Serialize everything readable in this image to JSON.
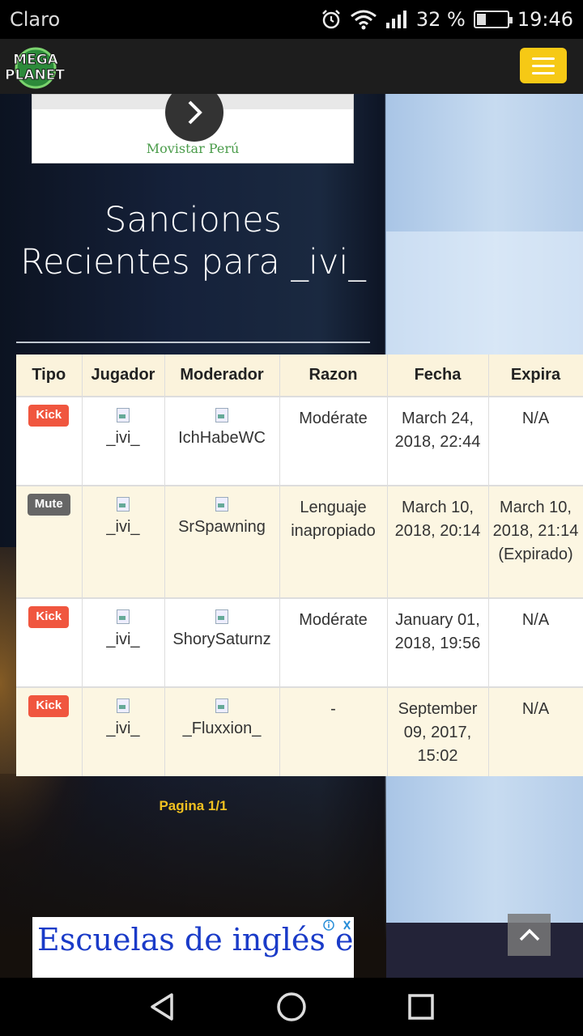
{
  "status_bar": {
    "carrier": "Claro",
    "battery_percent": "32 %",
    "battery_level": 0.32,
    "time": "19:46"
  },
  "header": {
    "logo_line1": "MEGA",
    "logo_line2": "PLANET"
  },
  "ad_top": {
    "advertiser": "Movistar Perú"
  },
  "page": {
    "title": "Sanciones Recientes para _ivi_"
  },
  "table": {
    "headers": [
      "Tipo",
      "Jugador",
      "Moderador",
      "Razon",
      "Fecha",
      "Expira"
    ],
    "rows": [
      {
        "tipo": "Kick",
        "jugador": "_ivi_",
        "moderador": "IchHabeWC",
        "razon": "Modérate",
        "fecha": "March 24, 2018, 22:44",
        "expira": "N/A"
      },
      {
        "tipo": "Mute",
        "jugador": "_ivi_",
        "moderador": "SrSpawning",
        "razon": "Lenguaje inapropiado",
        "fecha": "March 10, 2018, 20:14",
        "expira": "March 10, 2018, 21:14 (Expirado)"
      },
      {
        "tipo": "Kick",
        "jugador": "_ivi_",
        "moderador": "ShorySaturnz",
        "razon": "Modérate",
        "fecha": "January 01, 2018, 19:56",
        "expira": "N/A"
      },
      {
        "tipo": "Kick",
        "jugador": "_ivi_",
        "moderador": "_Fluxxion_",
        "razon": "-",
        "fecha": "September 09, 2017, 15:02",
        "expira": "N/A"
      }
    ]
  },
  "pagination": {
    "label": "Pagina 1/1"
  },
  "ad_bottom": {
    "text": "Escuelas de inglés en USA"
  },
  "colors": {
    "menu_button": "#f6c915",
    "kick_badge": "#f0563f",
    "mute_badge": "#666666",
    "pagination_text": "#f0c020",
    "ad_link": "#1a3bc8"
  },
  "icons": {
    "alarm": "alarm-icon",
    "wifi": "wifi-icon",
    "signal": "signal-icon",
    "battery": "battery-icon",
    "menu": "hamburger-icon",
    "next": "chevron-right-icon",
    "back_to_top": "chevron-up-icon",
    "nav_back": "triangle-back-icon",
    "nav_home": "circle-home-icon",
    "nav_recents": "square-recents-icon"
  }
}
